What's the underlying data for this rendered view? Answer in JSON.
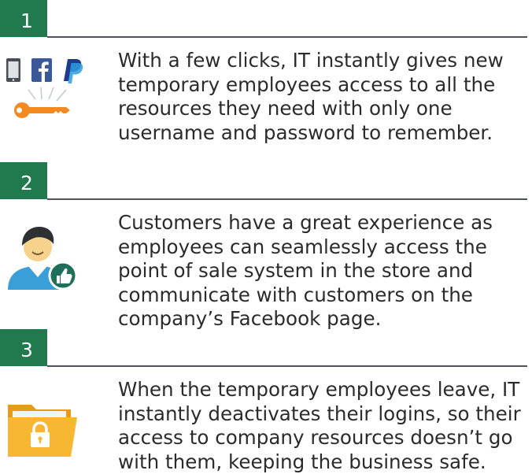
{
  "steps": [
    {
      "number": "1",
      "icon": "devices-key-icon",
      "text": "With a few clicks, IT instantly gives new temporary employees access to all the resources they need with only one username and password to remember."
    },
    {
      "number": "2",
      "icon": "user-thumbs-up-icon",
      "text": "Customers have a great experience as employees can seamlessly access the point of sale system in the store and communicate with customers on the company’s Facebook page."
    },
    {
      "number": "3",
      "icon": "locked-folder-icon",
      "text": "When the temporary employees leave, IT instantly deactivates their logins, so their access to company resources doesn’t go with them, keeping the business safe."
    }
  ],
  "colors": {
    "accent_green": "#207a4e",
    "rule": "#4f5357",
    "facebook_blue": "#3b5998",
    "paypal_blue": "#1f3a8f",
    "key_orange": "#f28a1f",
    "folder_yellow": "#f7b733"
  }
}
